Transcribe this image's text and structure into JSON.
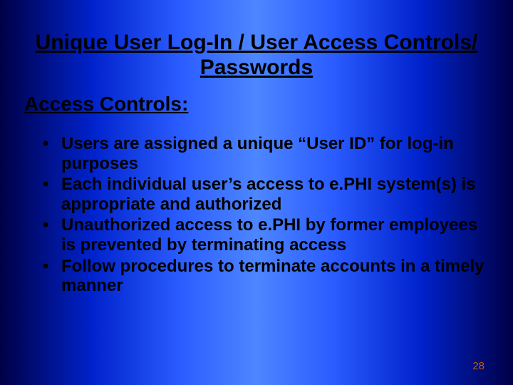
{
  "title": "Unique User Log-In / User Access Controls/ Passwords",
  "subtitle": "Access Controls:",
  "bullets": [
    "Users are assigned a unique “User ID” for log-in purposes",
    "Each individual user’s access to e.PHI system(s) is appropriate and authorized",
    "Unauthorized access to e.PHI by former employees is prevented by terminating access",
    "Follow procedures to terminate accounts in a timely manner"
  ],
  "page_number": "28"
}
